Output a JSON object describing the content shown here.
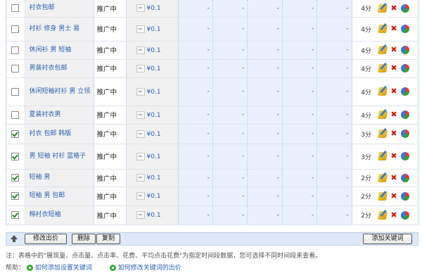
{
  "rows": [
    {
      "checked": false,
      "keyword": "衬衣包邮",
      "status": "推广中",
      "bid": "¥0.1",
      "metrics": [
        "-",
        "-",
        "-",
        "-",
        "-"
      ],
      "rank": "4分"
    },
    {
      "checked": false,
      "keyword": "衬衫 修身 男士 易",
      "status": "推广中",
      "bid": "¥0.1",
      "metrics": [
        "-",
        "-",
        "-",
        "-",
        "-"
      ],
      "rank": "4分"
    },
    {
      "checked": false,
      "keyword": "休闲衫 男 短袖",
      "status": "推广中",
      "bid": "¥0.1",
      "metrics": [
        "-",
        "-",
        "-",
        "-",
        "-"
      ],
      "rank": "4分"
    },
    {
      "checked": false,
      "keyword": "男装衬衣包邮",
      "status": "推广中",
      "bid": "¥0.1",
      "metrics": [
        "-",
        "-",
        "-",
        "-",
        "-"
      ],
      "rank": "4分"
    },
    {
      "checked": false,
      "keyword": "休闲短袖衬衫 男 立领",
      "status": "推广中",
      "bid": "¥0.1",
      "metrics": [
        "-",
        "-",
        "-",
        "-",
        "-"
      ],
      "rank": "4分"
    },
    {
      "checked": false,
      "keyword": "夏装衬衣男",
      "status": "推广中",
      "bid": "¥0.1",
      "metrics": [
        "-",
        "-",
        "-",
        "-",
        "-"
      ],
      "rank": "4分"
    },
    {
      "checked": true,
      "keyword": "衬衣 包邮 韩版",
      "status": "推广中",
      "bid": "¥0.1",
      "metrics": [
        "-",
        "-",
        "-",
        "-",
        "-"
      ],
      "rank": "3分"
    },
    {
      "checked": true,
      "keyword": "男 短袖 衬衫 蓝格子",
      "status": "推广中",
      "bid": "¥0.1",
      "metrics": [
        "-",
        "-",
        "-",
        "-",
        "-"
      ],
      "rank": "3分"
    },
    {
      "checked": true,
      "keyword": "短袖 男",
      "status": "推广中",
      "bid": "¥0.1",
      "metrics": [
        "-",
        "-",
        "-",
        "-",
        "-"
      ],
      "rank": "2分"
    },
    {
      "checked": true,
      "keyword": "短袖 男 包邮",
      "status": "推广中",
      "bid": "¥0.1",
      "metrics": [
        "-",
        "-",
        "-",
        "-",
        "-"
      ],
      "rank": "2分"
    },
    {
      "checked": true,
      "keyword": "棉衬衣短袖",
      "status": "推广中",
      "bid": "¥0.1",
      "metrics": [
        "-",
        "-",
        "-",
        "-",
        "-"
      ],
      "rank": "2分"
    }
  ],
  "row_heights": [
    24,
    34,
    26,
    26,
    40,
    26,
    28,
    36,
    25,
    27,
    27
  ],
  "toolbar": {
    "modify_bid": "修改出价",
    "delete": "删除",
    "copy": "复制",
    "add_keyword": "添加关键词"
  },
  "note": "注：表格中的\"展现量、点击量、点击率、花费、平均点击花费\"为指定时间段数据，您可选择不同时间段来查看。",
  "help": {
    "label": "帮助：",
    "link1": "如何添加设置关键词",
    "link2": "如何修改关键词的出价"
  },
  "colors": {
    "link": "#2a64b4",
    "metric_bg": "#e9f2fc",
    "footer_bg": "#dde9f6"
  }
}
